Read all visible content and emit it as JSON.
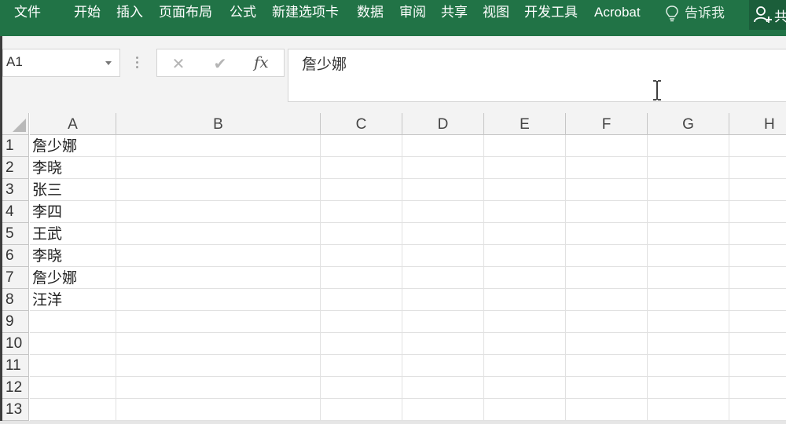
{
  "ribbon": {
    "tabs": [
      "文件",
      "开始",
      "插入",
      "页面布局",
      "公式",
      "新建选项卡",
      "数据",
      "审阅",
      "共享",
      "视图",
      "开发工具",
      "Acrobat"
    ],
    "tell_me": "告诉我",
    "share_label": "共"
  },
  "formula_bar": {
    "name_box": "A1",
    "cancel_symbol": "✕",
    "enter_symbol": "✔",
    "fx_label": "fx",
    "content": "詹少娜"
  },
  "sheet": {
    "columns": [
      "A",
      "B",
      "C",
      "D",
      "E",
      "F",
      "G",
      "H"
    ],
    "rows": [
      "1",
      "2",
      "3",
      "4",
      "5",
      "6",
      "7",
      "8",
      "9",
      "10",
      "11",
      "12",
      "13"
    ],
    "column_a_values": [
      "詹少娜",
      "李晓",
      "张三",
      "李四",
      "王武",
      "李晓",
      "詹少娜",
      "汪洋"
    ]
  },
  "colors": {
    "ribbon_green": "#217346",
    "header_gray": "#f3f3f3",
    "gridline": "#e1e1e1"
  },
  "icons": [
    "lightbulb-icon",
    "add-user-icon",
    "dropdown-caret-icon",
    "cancel-icon",
    "enter-check-icon",
    "fx-icon",
    "ibeam-cursor-icon",
    "select-all-corner-icon"
  ]
}
